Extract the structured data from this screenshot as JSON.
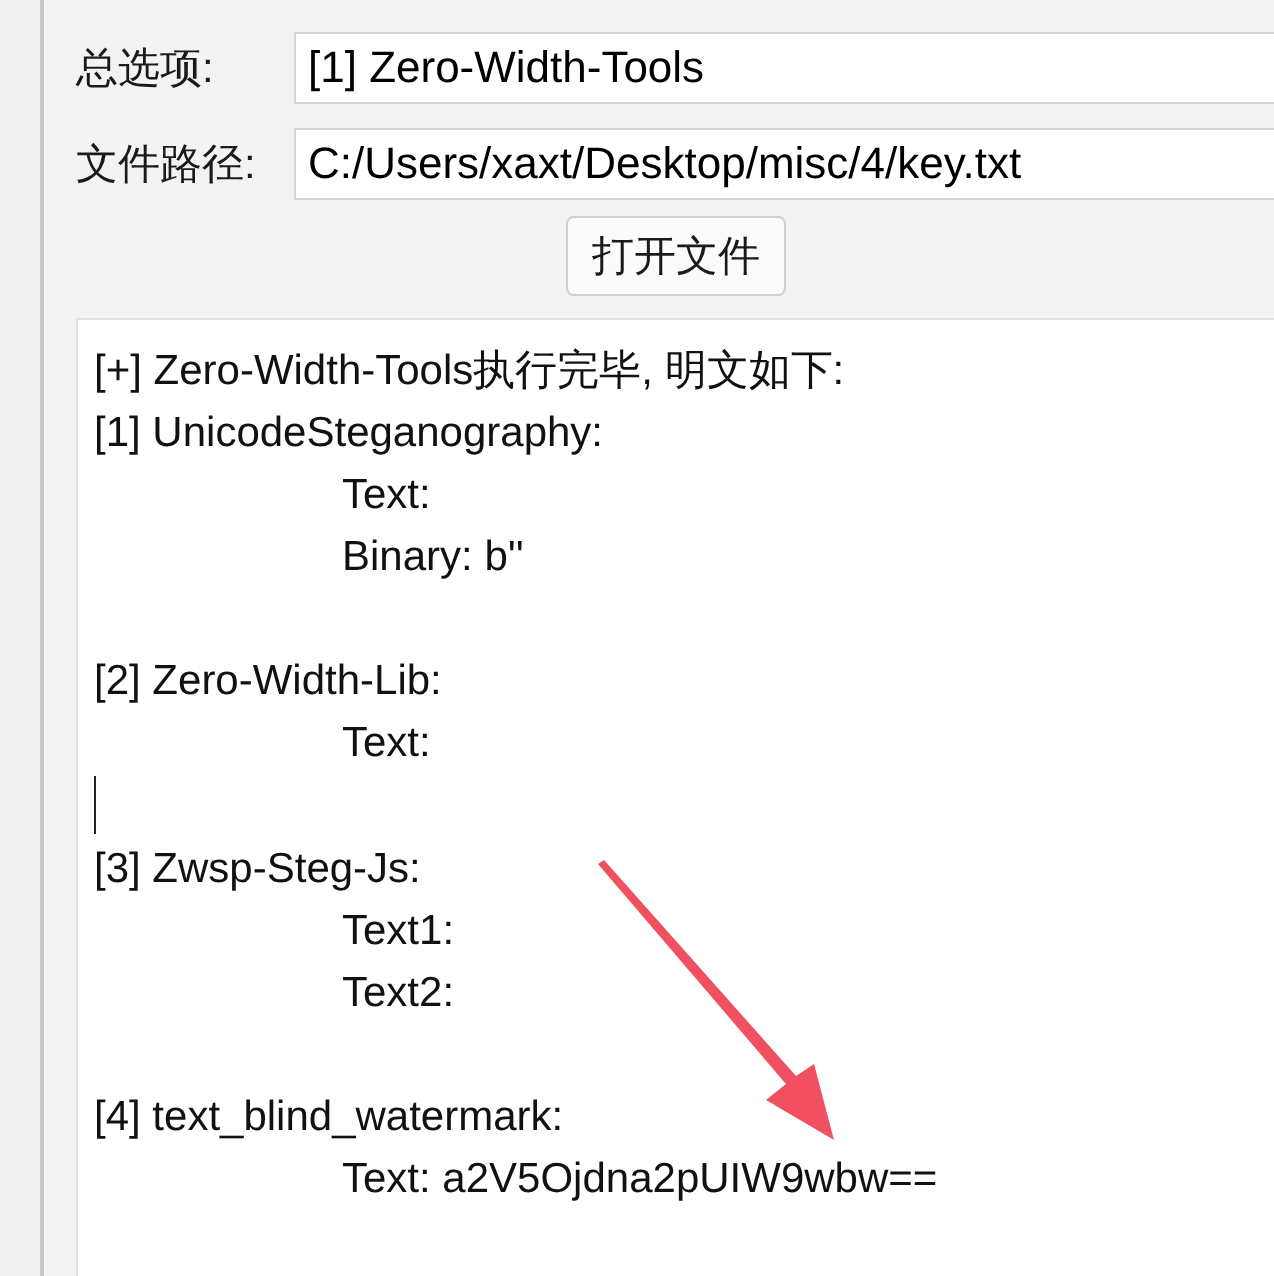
{
  "form": {
    "option_label": "总选项:",
    "option_value": "[1] Zero-Width-Tools",
    "path_label": "文件路径:",
    "path_value": "C:/Users/xaxt/Desktop/misc/4/key.txt",
    "open_button": "打开文件"
  },
  "output": {
    "lines": [
      {
        "kind": "heading",
        "text": "[+] Zero-Width-Tools执行完毕, 明文如下:"
      },
      {
        "kind": "heading",
        "text": "[1] UnicodeSteganography:"
      },
      {
        "kind": "indented",
        "text": "Text:"
      },
      {
        "kind": "indented",
        "text": "Binary: b''"
      },
      {
        "kind": "blank"
      },
      {
        "kind": "heading",
        "text": "[2] Zero-Width-Lib:"
      },
      {
        "kind": "indented",
        "text": "Text:"
      },
      {
        "kind": "cursor"
      },
      {
        "kind": "heading",
        "text": "[3] Zwsp-Steg-Js:"
      },
      {
        "kind": "indented",
        "text": "Text1:"
      },
      {
        "kind": "indented",
        "text": "Text2:"
      },
      {
        "kind": "blank"
      },
      {
        "kind": "heading",
        "text": "[4] text_blind_watermark:"
      },
      {
        "kind": "indented",
        "text": "Text: a2V5Ojdna2pUIW9wbw=="
      }
    ]
  }
}
